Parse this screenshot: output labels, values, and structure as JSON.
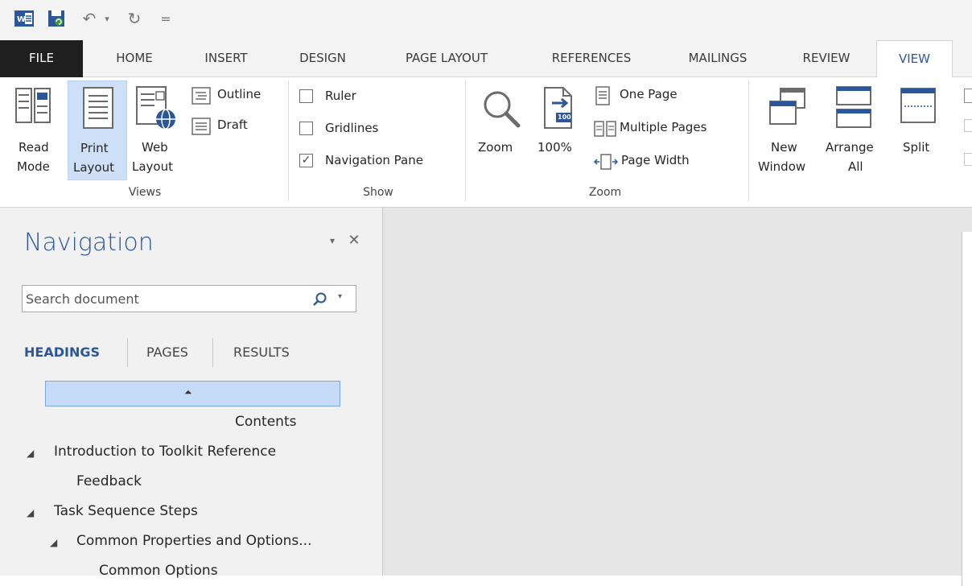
{
  "quick_access": {
    "undo_label": "↶",
    "redo_label": "↻",
    "more_label": "▾",
    "customize_label": "="
  },
  "tabs": [
    "FILE",
    "HOME",
    "INSERT",
    "DESIGN",
    "PAGE LAYOUT",
    "REFERENCES",
    "MAILINGS",
    "REVIEW",
    "VIEW"
  ],
  "ribbon": {
    "views": {
      "group_label": "Views",
      "read_mode": [
        "Read",
        "Mode"
      ],
      "print_layout": [
        "Print",
        "Layout"
      ],
      "web_layout": [
        "Web",
        "Layout"
      ],
      "outline": "Outline",
      "draft": "Draft"
    },
    "show": {
      "group_label": "Show",
      "ruler": "Ruler",
      "gridlines": "Gridlines",
      "navigation_pane": "Navigation Pane",
      "navigation_pane_checked": true
    },
    "zoom": {
      "group_label": "Zoom",
      "zoom": "Zoom",
      "hundred": "100%",
      "hundred_badge": "100",
      "one_page": "One Page",
      "multiple_pages": "Multiple Pages",
      "page_width": "Page Width"
    },
    "window": {
      "new_window": [
        "New",
        "Window"
      ],
      "arrange_all": [
        "Arrange",
        "All"
      ],
      "split": "Split"
    }
  },
  "navigation": {
    "title": "Navigation",
    "close_symbol": "✕",
    "menu_symbol": "▾",
    "search_placeholder": "Search document",
    "tabs": [
      "HEADINGS",
      "PAGES",
      "RESULTS"
    ],
    "active_tab": "HEADINGS",
    "collapse_symbol": "⏶",
    "headings": [
      {
        "text": "Contents",
        "level": 0,
        "expanded": null
      },
      {
        "text": "Introduction to Toolkit Reference",
        "level": 1,
        "expanded": true
      },
      {
        "text": "Feedback",
        "level": 2,
        "expanded": null
      },
      {
        "text": "Task Sequence Steps",
        "level": 1,
        "expanded": true
      },
      {
        "text": "Common Properties and Options...",
        "level": 2,
        "expanded": true
      },
      {
        "text": "Common Options",
        "level": 3,
        "expanded": null
      }
    ]
  },
  "colors": {
    "accent": "#2b579a",
    "file_tab": "#1f1f1f",
    "selected_button": "#cde0f7",
    "heading_highlight": "#c5dbf7"
  }
}
